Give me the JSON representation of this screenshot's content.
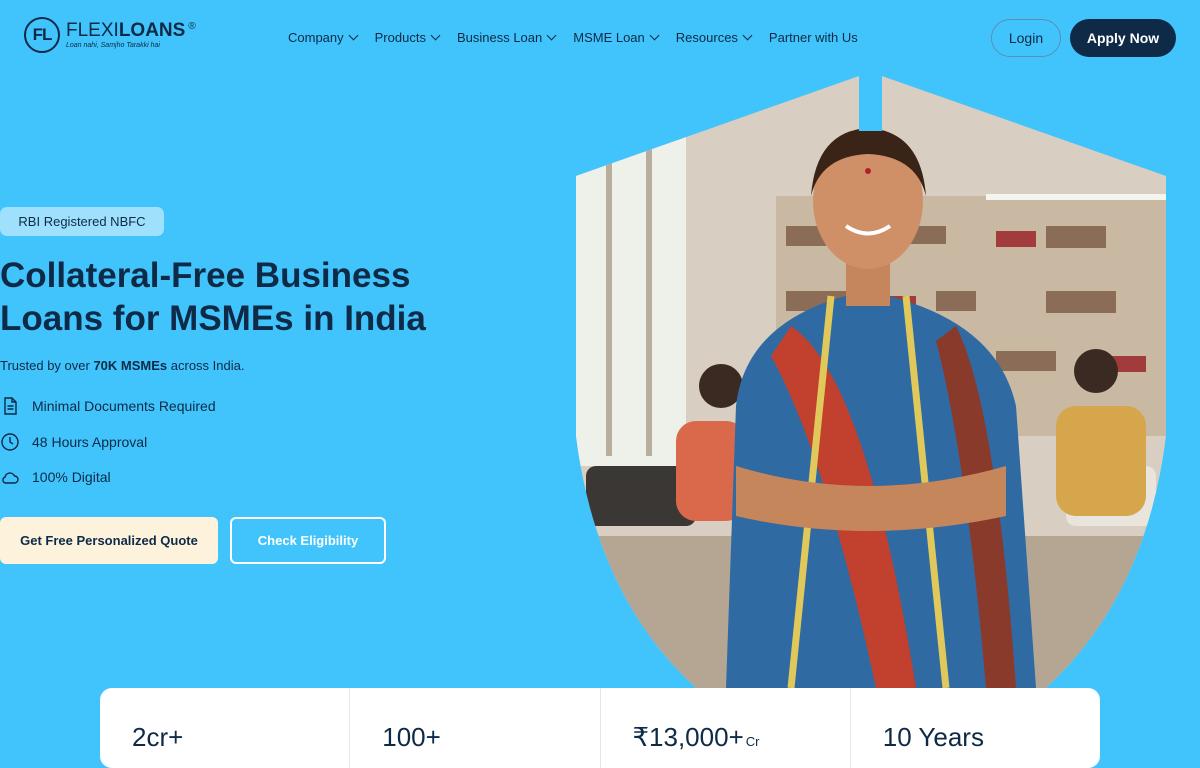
{
  "brand": {
    "mark": "FL",
    "name_light": "FLEXI",
    "name_bold": "LOANS",
    "reg": "®",
    "tagline": "Loan nahi, Samjho Tarakki hai"
  },
  "nav": {
    "items": [
      {
        "label": "Company",
        "dropdown": true
      },
      {
        "label": "Products",
        "dropdown": true
      },
      {
        "label": "Business Loan",
        "dropdown": true
      },
      {
        "label": "MSME Loan",
        "dropdown": true
      },
      {
        "label": "Resources",
        "dropdown": true
      },
      {
        "label": "Partner with Us",
        "dropdown": false
      }
    ],
    "login": "Login",
    "apply": "Apply Now"
  },
  "hero": {
    "badge": "RBI Registered NBFC",
    "title_line1": "Collateral-Free Business",
    "title_line2": "Loans for MSMEs in India",
    "trust_pre": "Trusted by over ",
    "trust_bold": "70K MSMEs",
    "trust_post": " across India.",
    "features": [
      {
        "icon": "document-icon",
        "label": "Minimal Documents Required"
      },
      {
        "icon": "clock-icon",
        "label": "48 Hours Approval"
      },
      {
        "icon": "cloud-icon",
        "label": "100% Digital"
      }
    ],
    "cta_primary": "Get Free Personalized Quote",
    "cta_secondary": "Check Eligibility"
  },
  "stats": [
    {
      "value": "2cr+",
      "unit": ""
    },
    {
      "value": "100+",
      "unit": ""
    },
    {
      "value": "₹13,000+",
      "unit": "Cr"
    },
    {
      "value": "10 Years",
      "unit": ""
    }
  ],
  "colors": {
    "background": "#41c4fb",
    "navy": "#0e2a47",
    "badge": "#9fe1fd",
    "cta_primary": "#fdf3dd"
  }
}
